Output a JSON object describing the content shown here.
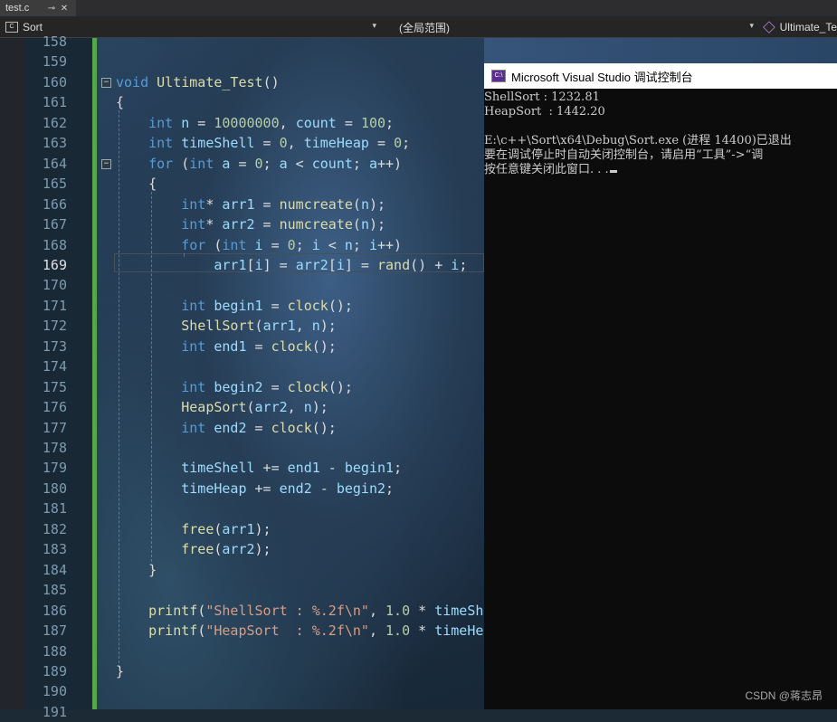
{
  "tab": {
    "label": "test.c",
    "pin": "⊸",
    "close": "✕"
  },
  "navbar": {
    "project": "Sort",
    "scope": "(全局范围)",
    "member": "Ultimate_Te"
  },
  "lines": [
    {
      "n": "158",
      "tokens": []
    },
    {
      "n": "159",
      "tokens": []
    },
    {
      "n": "160",
      "tokens": [
        [
          "kw",
          "void"
        ],
        [
          "t",
          " "
        ],
        [
          "fn",
          "Ultimate_Test"
        ],
        [
          "t",
          "()"
        ]
      ]
    },
    {
      "n": "161",
      "tokens": [
        [
          "t",
          "{"
        ]
      ]
    },
    {
      "n": "162",
      "tokens": [
        [
          "t",
          "    "
        ],
        [
          "kw",
          "int"
        ],
        [
          "t",
          " "
        ],
        [
          "var",
          "n"
        ],
        [
          "t",
          " = "
        ],
        [
          "num",
          "10000000"
        ],
        [
          "t",
          ", "
        ],
        [
          "var",
          "count"
        ],
        [
          "t",
          " = "
        ],
        [
          "num",
          "100"
        ],
        [
          "t",
          ";"
        ]
      ]
    },
    {
      "n": "163",
      "tokens": [
        [
          "t",
          "    "
        ],
        [
          "kw",
          "int"
        ],
        [
          "t",
          " "
        ],
        [
          "var",
          "timeShell"
        ],
        [
          "t",
          " = "
        ],
        [
          "num",
          "0"
        ],
        [
          "t",
          ", "
        ],
        [
          "var",
          "timeHeap"
        ],
        [
          "t",
          " = "
        ],
        [
          "num",
          "0"
        ],
        [
          "t",
          ";"
        ]
      ]
    },
    {
      "n": "164",
      "tokens": [
        [
          "t",
          "    "
        ],
        [
          "kw",
          "for"
        ],
        [
          "t",
          " ("
        ],
        [
          "kw",
          "int"
        ],
        [
          "t",
          " "
        ],
        [
          "var",
          "a"
        ],
        [
          "t",
          " = "
        ],
        [
          "num",
          "0"
        ],
        [
          "t",
          "; "
        ],
        [
          "var",
          "a"
        ],
        [
          "t",
          " < "
        ],
        [
          "var",
          "count"
        ],
        [
          "t",
          "; "
        ],
        [
          "var",
          "a"
        ],
        [
          "t",
          "++)"
        ]
      ]
    },
    {
      "n": "165",
      "tokens": [
        [
          "t",
          "    {"
        ]
      ]
    },
    {
      "n": "166",
      "tokens": [
        [
          "t",
          "        "
        ],
        [
          "kw",
          "int"
        ],
        [
          "t",
          "* "
        ],
        [
          "var",
          "arr1"
        ],
        [
          "t",
          " = "
        ],
        [
          "fn",
          "numcreate"
        ],
        [
          "t",
          "("
        ],
        [
          "var",
          "n"
        ],
        [
          "t",
          ");"
        ]
      ]
    },
    {
      "n": "167",
      "tokens": [
        [
          "t",
          "        "
        ],
        [
          "kw",
          "int"
        ],
        [
          "t",
          "* "
        ],
        [
          "var",
          "arr2"
        ],
        [
          "t",
          " = "
        ],
        [
          "fn",
          "numcreate"
        ],
        [
          "t",
          "("
        ],
        [
          "var",
          "n"
        ],
        [
          "t",
          ");"
        ]
      ]
    },
    {
      "n": "168",
      "tokens": [
        [
          "t",
          "        "
        ],
        [
          "kw",
          "for"
        ],
        [
          "t",
          " ("
        ],
        [
          "kw",
          "int"
        ],
        [
          "t",
          " "
        ],
        [
          "var",
          "i"
        ],
        [
          "t",
          " = "
        ],
        [
          "num",
          "0"
        ],
        [
          "t",
          "; "
        ],
        [
          "var",
          "i"
        ],
        [
          "t",
          " < "
        ],
        [
          "var",
          "n"
        ],
        [
          "t",
          "; "
        ],
        [
          "var",
          "i"
        ],
        [
          "t",
          "++)"
        ]
      ]
    },
    {
      "n": "169",
      "tokens": [
        [
          "t",
          "            "
        ],
        [
          "var",
          "arr1"
        ],
        [
          "t",
          "["
        ],
        [
          "var",
          "i"
        ],
        [
          "t",
          "] = "
        ],
        [
          "var",
          "arr2"
        ],
        [
          "t",
          "["
        ],
        [
          "var",
          "i"
        ],
        [
          "t",
          "] = "
        ],
        [
          "fn",
          "rand"
        ],
        [
          "t",
          "() + "
        ],
        [
          "var",
          "i"
        ],
        [
          "t",
          ";"
        ]
      ]
    },
    {
      "n": "170",
      "tokens": []
    },
    {
      "n": "171",
      "tokens": [
        [
          "t",
          "        "
        ],
        [
          "kw",
          "int"
        ],
        [
          "t",
          " "
        ],
        [
          "var",
          "begin1"
        ],
        [
          "t",
          " = "
        ],
        [
          "fn",
          "clock"
        ],
        [
          "t",
          "();"
        ]
      ]
    },
    {
      "n": "172",
      "tokens": [
        [
          "t",
          "        "
        ],
        [
          "fn",
          "ShellSort"
        ],
        [
          "t",
          "("
        ],
        [
          "var",
          "arr1"
        ],
        [
          "t",
          ", "
        ],
        [
          "var",
          "n"
        ],
        [
          "t",
          ");"
        ]
      ]
    },
    {
      "n": "173",
      "tokens": [
        [
          "t",
          "        "
        ],
        [
          "kw",
          "int"
        ],
        [
          "t",
          " "
        ],
        [
          "var",
          "end1"
        ],
        [
          "t",
          " = "
        ],
        [
          "fn",
          "clock"
        ],
        [
          "t",
          "();"
        ]
      ]
    },
    {
      "n": "174",
      "tokens": []
    },
    {
      "n": "175",
      "tokens": [
        [
          "t",
          "        "
        ],
        [
          "kw",
          "int"
        ],
        [
          "t",
          " "
        ],
        [
          "var",
          "begin2"
        ],
        [
          "t",
          " = "
        ],
        [
          "fn",
          "clock"
        ],
        [
          "t",
          "();"
        ]
      ]
    },
    {
      "n": "176",
      "tokens": [
        [
          "t",
          "        "
        ],
        [
          "fn",
          "HeapSort"
        ],
        [
          "t",
          "("
        ],
        [
          "var",
          "arr2"
        ],
        [
          "t",
          ", "
        ],
        [
          "var",
          "n"
        ],
        [
          "t",
          ");"
        ]
      ]
    },
    {
      "n": "177",
      "tokens": [
        [
          "t",
          "        "
        ],
        [
          "kw",
          "int"
        ],
        [
          "t",
          " "
        ],
        [
          "var",
          "end2"
        ],
        [
          "t",
          " = "
        ],
        [
          "fn",
          "clock"
        ],
        [
          "t",
          "();"
        ]
      ]
    },
    {
      "n": "178",
      "tokens": []
    },
    {
      "n": "179",
      "tokens": [
        [
          "t",
          "        "
        ],
        [
          "var",
          "timeShell"
        ],
        [
          "t",
          " += "
        ],
        [
          "var",
          "end1"
        ],
        [
          "t",
          " - "
        ],
        [
          "var",
          "begin1"
        ],
        [
          "t",
          ";"
        ]
      ]
    },
    {
      "n": "180",
      "tokens": [
        [
          "t",
          "        "
        ],
        [
          "var",
          "timeHeap"
        ],
        [
          "t",
          " += "
        ],
        [
          "var",
          "end2"
        ],
        [
          "t",
          " - "
        ],
        [
          "var",
          "begin2"
        ],
        [
          "t",
          ";"
        ]
      ]
    },
    {
      "n": "181",
      "tokens": []
    },
    {
      "n": "182",
      "tokens": [
        [
          "t",
          "        "
        ],
        [
          "fn",
          "free"
        ],
        [
          "t",
          "("
        ],
        [
          "var",
          "arr1"
        ],
        [
          "t",
          ");"
        ]
      ]
    },
    {
      "n": "183",
      "tokens": [
        [
          "t",
          "        "
        ],
        [
          "fn",
          "free"
        ],
        [
          "t",
          "("
        ],
        [
          "var",
          "arr2"
        ],
        [
          "t",
          ");"
        ]
      ]
    },
    {
      "n": "184",
      "tokens": [
        [
          "t",
          "    }"
        ]
      ]
    },
    {
      "n": "185",
      "tokens": []
    },
    {
      "n": "186",
      "tokens": [
        [
          "t",
          "    "
        ],
        [
          "fn",
          "printf"
        ],
        [
          "t",
          "("
        ],
        [
          "str",
          "\"ShellSort : %.2f\\n\""
        ],
        [
          "t",
          ", "
        ],
        [
          "num",
          "1.0"
        ],
        [
          "t",
          " * "
        ],
        [
          "var",
          "timeSh"
        ]
      ]
    },
    {
      "n": "187",
      "tokens": [
        [
          "t",
          "    "
        ],
        [
          "fn",
          "printf"
        ],
        [
          "t",
          "("
        ],
        [
          "str",
          "\"HeapSort  : %.2f\\n\""
        ],
        [
          "t",
          ", "
        ],
        [
          "num",
          "1.0"
        ],
        [
          "t",
          " * "
        ],
        [
          "var",
          "timeHe"
        ]
      ]
    },
    {
      "n": "188",
      "tokens": []
    },
    {
      "n": "189",
      "tokens": [
        [
          "t",
          "}"
        ]
      ]
    },
    {
      "n": "190",
      "tokens": []
    },
    {
      "n": "191",
      "tokens": []
    }
  ],
  "active_line": "169",
  "console": {
    "title": "Microsoft Visual Studio 调试控制台",
    "lines": [
      "ShellSort : 1232.81",
      "HeapSort  : 1442.20",
      "",
      "E:\\c++\\Sort\\x64\\Debug\\Sort.exe (进程 14400)已退出",
      "要在调试停止时自动关闭控制台，请启用“工具”->“调",
      "按任意键关闭此窗口. . ."
    ]
  },
  "watermark": "CSDN @蒋志昂"
}
